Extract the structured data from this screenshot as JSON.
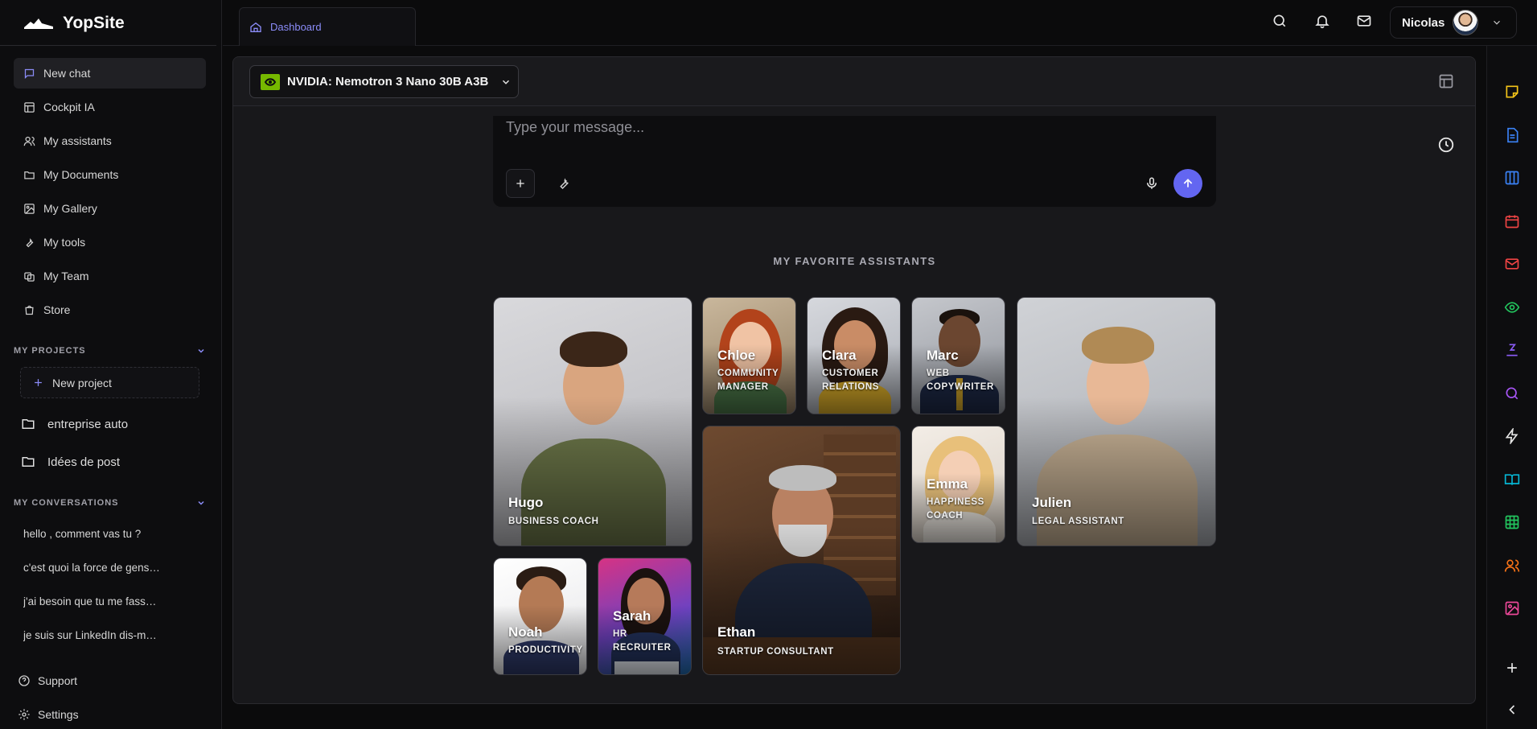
{
  "brand": {
    "name": "YopSite"
  },
  "sidebar": {
    "nav": [
      {
        "label": "New chat",
        "icon": "message-square-icon"
      },
      {
        "label": "Cockpit IA",
        "icon": "layout-icon"
      },
      {
        "label": "My assistants",
        "icon": "users-icon"
      },
      {
        "label": "My Documents",
        "icon": "folder-icon"
      },
      {
        "label": "My Gallery",
        "icon": "image-icon"
      },
      {
        "label": "My tools",
        "icon": "wrench-icon"
      },
      {
        "label": "My Team",
        "icon": "team-icon"
      },
      {
        "label": "Store",
        "icon": "store-icon"
      }
    ],
    "projects_title": "MY PROJECTS",
    "new_project_label": "New project",
    "projects": [
      "entreprise auto",
      "Idées de post"
    ],
    "conversations_title": "MY CONVERSATIONS",
    "conversations": [
      "hello , comment vas tu ?",
      "c'est quoi la force de gens…",
      "j'ai besoin que tu me fass…",
      "je suis sur LinkedIn dis-m…"
    ],
    "footer": [
      {
        "label": "Support",
        "icon": "help-circle-icon"
      },
      {
        "label": "Settings",
        "icon": "gear-icon"
      }
    ]
  },
  "topbar": {
    "tab_label": "Dashboard",
    "user_name": "Nicolas"
  },
  "panel": {
    "model_name": "NVIDIA: Nemotron 3 Nano 30B A3B",
    "composer_placeholder": "Type your message...",
    "favorites_title": "MY FAVORITE ASSISTANTS"
  },
  "assistants": [
    {
      "name": "Hugo",
      "role": "BUSINESS COACH"
    },
    {
      "name": "Chloe",
      "role": "COMMUNITY MANAGER"
    },
    {
      "name": "Clara",
      "role": "CUSTOMER RELATIONS"
    },
    {
      "name": "Marc",
      "role": "WEB COPYWRITER"
    },
    {
      "name": "Julien",
      "role": "LEGAL ASSISTANT"
    },
    {
      "name": "Ethan",
      "role": "STARTUP CONSULTANT"
    },
    {
      "name": "Emma",
      "role": "HAPPINESS COACH"
    },
    {
      "name": "Noah",
      "role": "PRODUCTIVITY"
    },
    {
      "name": "Sarah",
      "role": "HR RECRUITER"
    }
  ],
  "colors": {
    "accent": "#6366f1",
    "tab_text": "#8b8cf8",
    "nvidia_green": "#76b900"
  }
}
